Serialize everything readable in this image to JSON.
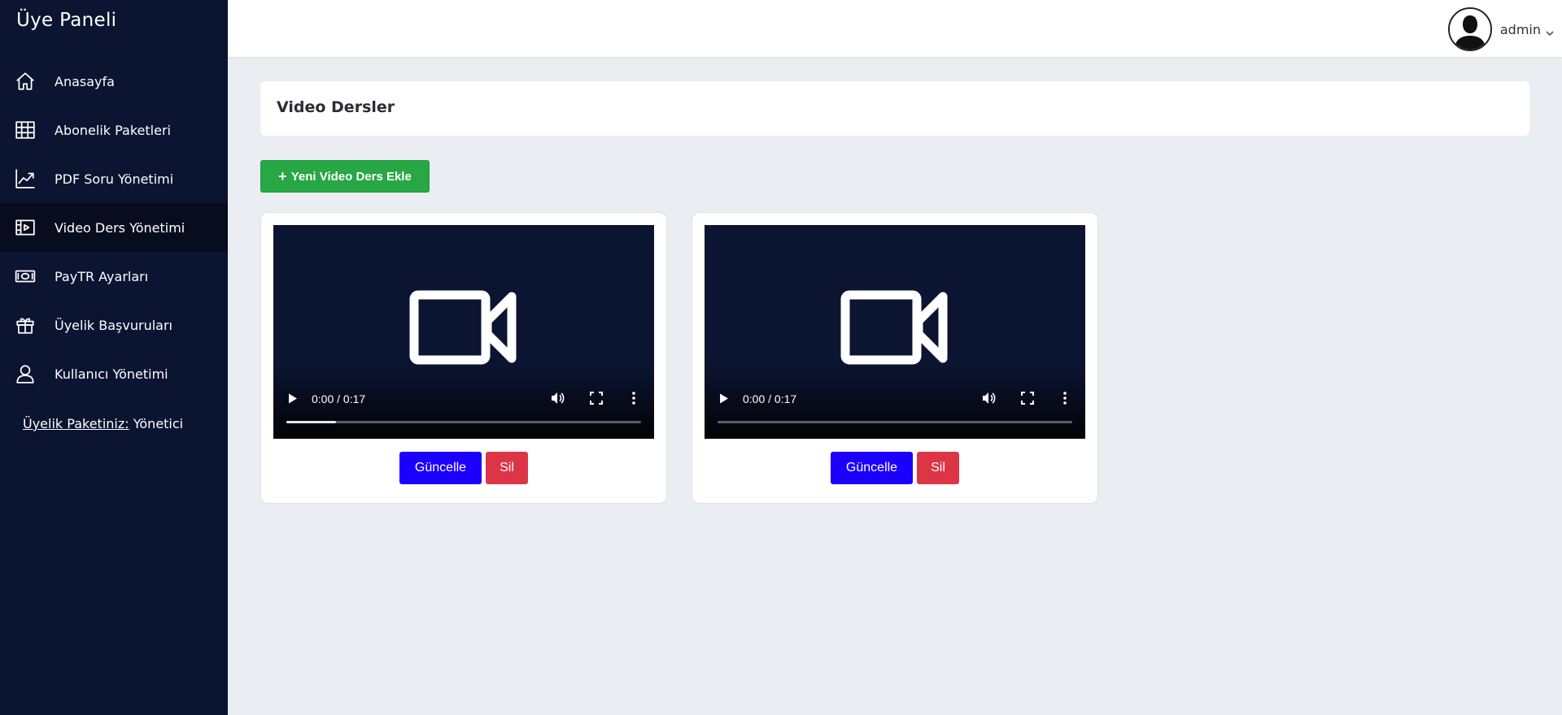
{
  "sidebar": {
    "brand": "Üye Paneli",
    "items": [
      {
        "label": "Anasayfa",
        "icon": "home-icon"
      },
      {
        "label": "Abonelik Paketleri",
        "icon": "table-icon"
      },
      {
        "label": "PDF Soru Yönetimi",
        "icon": "chart-line-icon"
      },
      {
        "label": "Video Ders Yönetimi",
        "icon": "film-icon",
        "active": true
      },
      {
        "label": "PayTR Ayarları",
        "icon": "money-icon"
      },
      {
        "label": "Üyelik Başvuruları",
        "icon": "gift-box-icon"
      },
      {
        "label": "Kullanıcı Yönetimi",
        "icon": "user-icon"
      }
    ],
    "membership_label": "Üyelik Paketiniz:",
    "membership_value": "Yönetici"
  },
  "topbar": {
    "user_name": "admin"
  },
  "page": {
    "title": "Video Dersler",
    "add_button": "Yeni Video Ders Ekle"
  },
  "videos": [
    {
      "time": "0:00 / 0:17",
      "progress": 0.14,
      "update_label": "Güncelle",
      "delete_label": "Sil"
    },
    {
      "time": "0:00 / 0:17",
      "progress": 0,
      "update_label": "Güncelle",
      "delete_label": "Sil"
    }
  ],
  "colors": {
    "sidebar_bg": "#0b1430",
    "add_button": "#28a745",
    "update_button": "#1b00ff",
    "delete_button": "#dc3545"
  }
}
